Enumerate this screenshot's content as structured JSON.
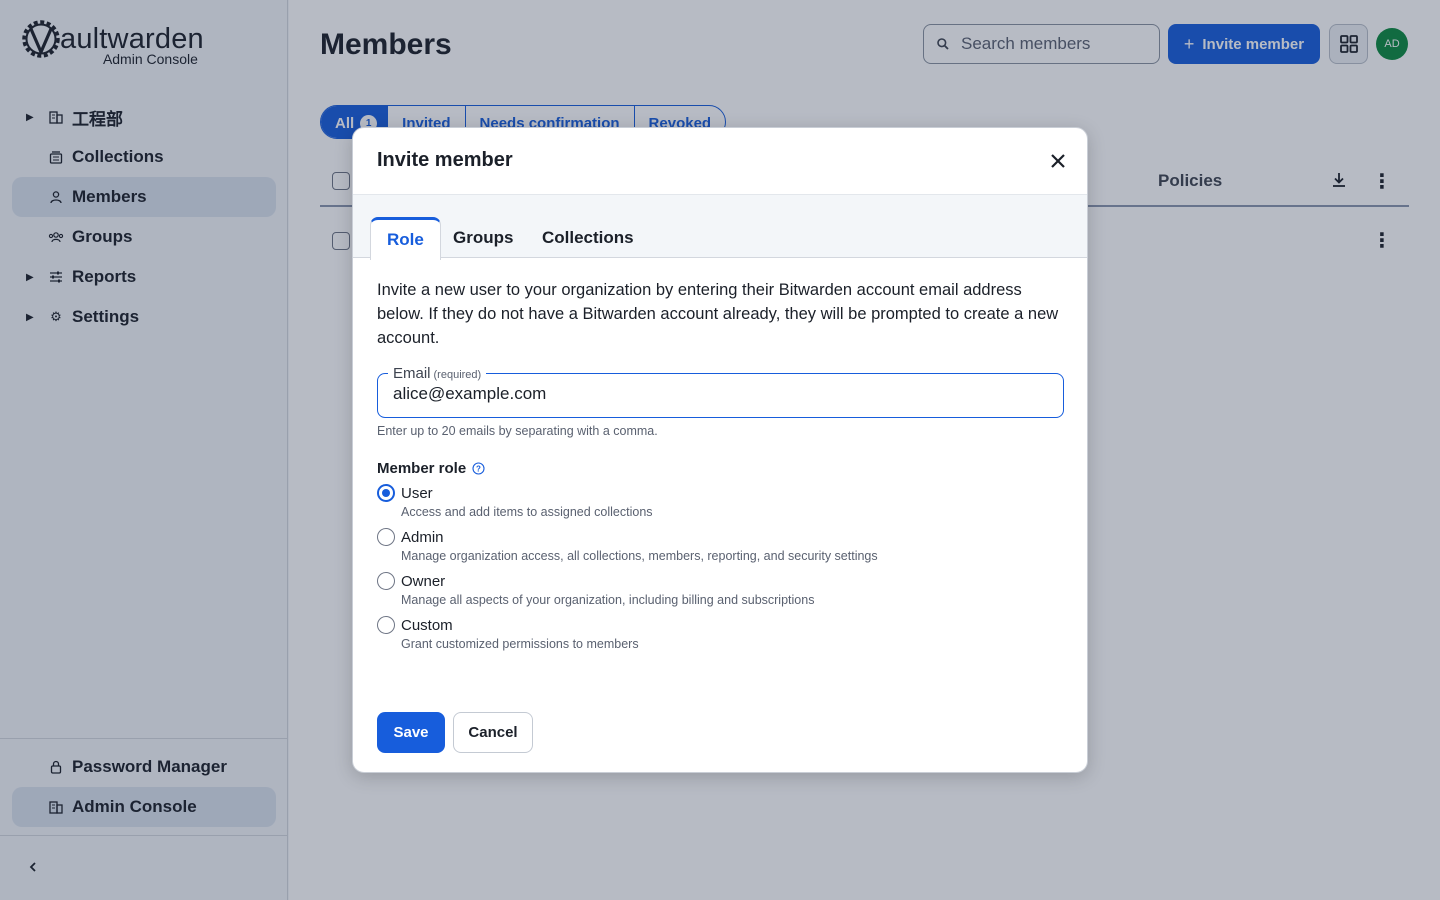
{
  "app": {
    "logo_word": "aultwarden",
    "logo_sub": "Admin Console",
    "logo_icon": "vaultwarden-gear-v-icon"
  },
  "sidebar": {
    "items": [
      {
        "label": "工程部",
        "icon": "org-building-icon",
        "expandable": true,
        "active": false
      },
      {
        "label": "Collections",
        "icon": "collections-icon",
        "expandable": false,
        "active": false
      },
      {
        "label": "Members",
        "icon": "member-person-icon",
        "expandable": false,
        "active": true
      },
      {
        "label": "Groups",
        "icon": "groups-icon",
        "expandable": false,
        "active": false
      },
      {
        "label": "Reports",
        "icon": "reports-sliders-icon",
        "expandable": true,
        "active": false
      },
      {
        "label": "Settings",
        "icon": "gear-icon",
        "expandable": true,
        "active": false
      }
    ],
    "bottom_items": [
      {
        "label": "Password Manager",
        "icon": "lock-icon",
        "active": false
      },
      {
        "label": "Admin Console",
        "icon": "building-icon",
        "active": true
      }
    ],
    "collapse_icon": "chevron-left-icon"
  },
  "header": {
    "title": "Members",
    "search_placeholder": "Search members",
    "invite_label": "Invite member",
    "avatar_initials": "AD"
  },
  "filters": {
    "tabs": [
      {
        "label": "All",
        "count": "1",
        "active": true
      },
      {
        "label": "Invited"
      },
      {
        "label": "Needs confirmation"
      },
      {
        "label": "Revoked"
      }
    ]
  },
  "table": {
    "col_policies": "Policies"
  },
  "dialog": {
    "title": "Invite member",
    "tabs": [
      {
        "label": "Role",
        "active": true
      },
      {
        "label": "Groups"
      },
      {
        "label": "Collections"
      }
    ],
    "intro": "Invite a new user to your organization by entering their Bitwarden account email address below. If they do not have a Bitwarden account already, they will be prompted to create a new account.",
    "email_label": "Email",
    "email_required": "(required)",
    "email_value": "alice@example.com",
    "email_hint": "Enter up to 20 emails by separating with a comma.",
    "role_label": "Member role",
    "roles": [
      {
        "title": "User",
        "desc": "Access and add items to assigned collections",
        "checked": true
      },
      {
        "title": "Admin",
        "desc": "Manage organization access, all collections, members, reporting, and security settings",
        "checked": false
      },
      {
        "title": "Owner",
        "desc": "Manage all aspects of your organization, including billing and subscriptions",
        "checked": false
      },
      {
        "title": "Custom",
        "desc": "Grant customized permissions to members",
        "checked": false
      }
    ],
    "save_label": "Save",
    "cancel_label": "Cancel"
  },
  "colors": {
    "primary": "#175ddc",
    "avatar_bg": "#0b8a3f",
    "overlay": "rgba(30,44,72,0.32)"
  }
}
